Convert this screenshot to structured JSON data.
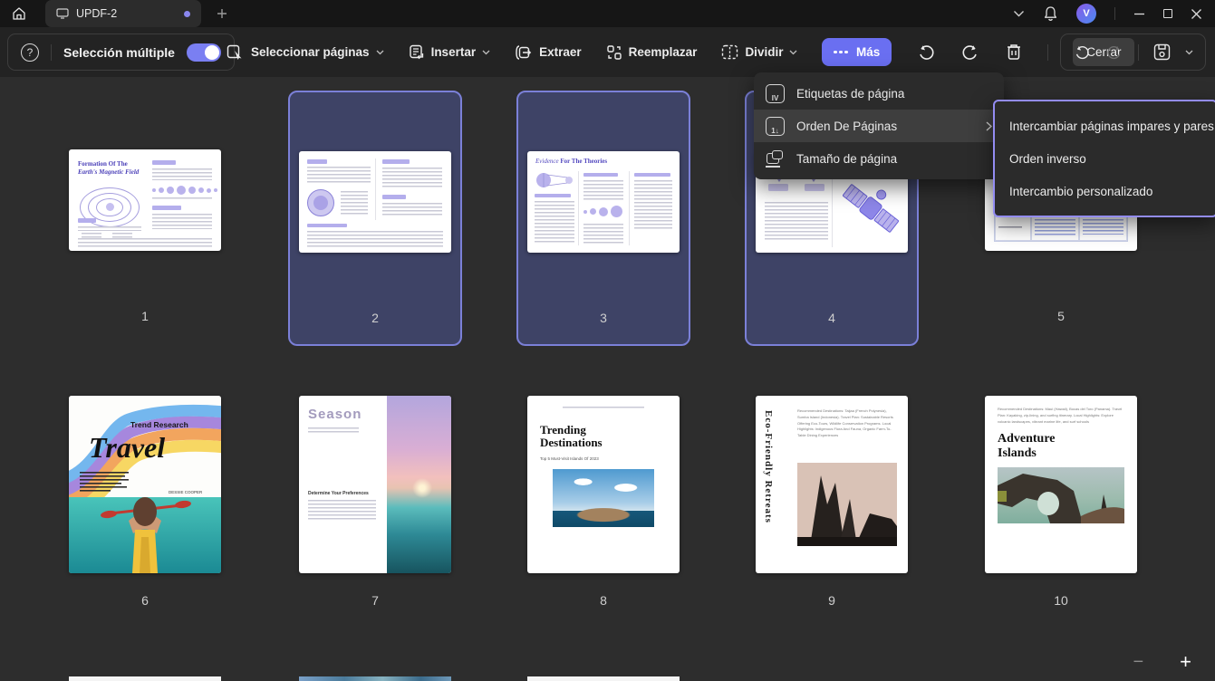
{
  "titlebar": {
    "tab_title": "UPDF-2",
    "avatar_letter": "V"
  },
  "toolbar": {
    "help_glyph": "?",
    "multi_select_label": "Selección múltiple",
    "select_pages_label": "Seleccionar páginas",
    "insert_label": "Insertar",
    "extract_label": "Extraer",
    "replace_label": "Reemplazar",
    "split_label": "Dividir",
    "more_label": "Más",
    "close_label": "Cerrar"
  },
  "more_menu": {
    "items": [
      {
        "label": "Etiquetas de página",
        "glyph": "IV"
      },
      {
        "label": "Orden De Páginas",
        "glyph": "1↓"
      },
      {
        "label": "Tamaño de página",
        "glyph": ""
      }
    ]
  },
  "order_submenu": {
    "items": [
      {
        "label": "Intercambiar páginas impares y pares"
      },
      {
        "label": "Orden inverso"
      },
      {
        "label": "Intercambio personalizado"
      }
    ]
  },
  "pages": [
    {
      "number": "1",
      "selected": false,
      "title_line1": "Formation Of The",
      "title_line2": "Earth's Magnetic Field"
    },
    {
      "number": "2",
      "selected": true
    },
    {
      "number": "3",
      "selected": true,
      "title_part1": "Evidence",
      "title_part2": " For The Theories"
    },
    {
      "number": "4",
      "selected": true
    },
    {
      "number": "5",
      "selected": false
    },
    {
      "number": "6",
      "selected": false,
      "kicker": "Trend Research",
      "title": "Travel",
      "byline": "DESSIE COOPER"
    },
    {
      "number": "7",
      "selected": false,
      "title": "Season",
      "subheading": "Determine Your Preferences"
    },
    {
      "number": "8",
      "selected": false,
      "title": "Trending Destinations",
      "subtitle": "Top 5 Must-Visit Islands Of 2023"
    },
    {
      "number": "9",
      "selected": false,
      "title": "Eco-Friendly Retreats",
      "details": "Recommended Destinations: Taijaa (French Polynesia), Sumba Island (Indonesia). Travel Plan: Sustainable Resorts Offering Eco-Tours, Wildlife Conservation Programs. Local Highlights: Indigenous Flora And Fauna, Organic Farm-To-Table Dining Experiences"
    },
    {
      "number": "10",
      "selected": false,
      "title": "Adventure Islands",
      "details": "Recommended Destinations: Maui (Hawaii), Bocas del Toro (Panama). Travel Plan: Kayaking, zip-lining, and surfing itinerary. Local Highlights: Explore volcanic landscapes, vibrant marine life, and surf schools"
    }
  ],
  "zoom_controls": {
    "zoom_out": "−",
    "zoom_in": "+"
  },
  "colors": {
    "accent": "#6a6ff1",
    "selected_card_bg": "#3e4366",
    "selected_card_border": "#7b80d8",
    "submenu_border": "#938cf2",
    "toggle_on": "#7a7ff2"
  }
}
